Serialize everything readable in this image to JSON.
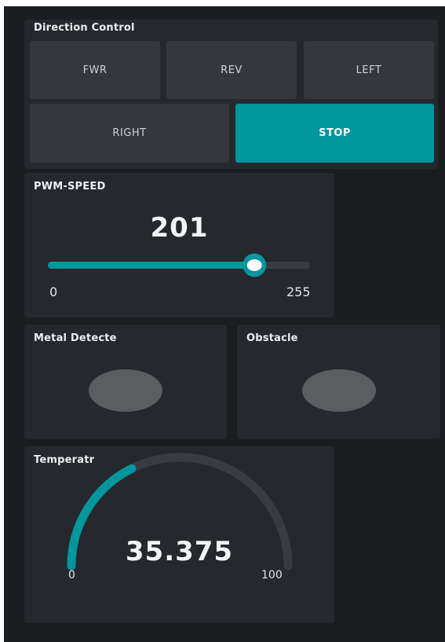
{
  "direction_control": {
    "title": "Direction Control",
    "buttons": [
      {
        "label": "FWR",
        "active": false
      },
      {
        "label": "REV",
        "active": false
      },
      {
        "label": "LEFT",
        "active": false
      },
      {
        "label": "RIGHT",
        "active": false
      },
      {
        "label": "STOP",
        "active": true
      }
    ]
  },
  "pwm_speed": {
    "title": "PWM-SPEED",
    "value": "201",
    "min": "0",
    "max": "255",
    "fraction": 0.788
  },
  "metal": {
    "title": "Metal Detecte",
    "state": "off"
  },
  "obstacle": {
    "title": "Obstacle",
    "state": "off"
  },
  "temperature": {
    "title": "Temperatr",
    "value": "35.375",
    "min": "0",
    "max": "100",
    "fraction": 0.354
  },
  "colors": {
    "accent": "#00979d",
    "background": "#1b1e21",
    "card": "#25282c",
    "button": "#34383d",
    "led_off": "#5b5e61"
  }
}
